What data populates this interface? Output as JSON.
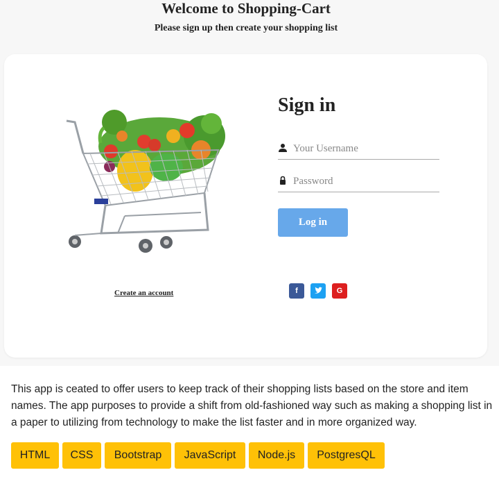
{
  "header": {
    "title": "Welcome to Shopping-Cart",
    "subtitle": "Please sign up then create your shopping list"
  },
  "signin": {
    "title": "Sign in",
    "username_placeholder": "Your Username",
    "password_placeholder": "Password",
    "login_label": "Log in",
    "create_account_label": "Create an account"
  },
  "social": [
    {
      "icon": "facebook-icon",
      "glyph": "f",
      "color": "#3b5998"
    },
    {
      "icon": "twitter-icon",
      "glyph": "t",
      "color": "#1da1f2"
    },
    {
      "icon": "google-icon",
      "glyph": "G",
      "color": "#dd1f1f"
    }
  ],
  "description": "This app is ceated to offer users to keep track of their shopping lists based on the store and item names. The app purposes to provide a shift from old-fashioned way such as making a shopping list in a paper to utilizing from technology to make the list faster and in more organized way.",
  "tech_badges": [
    "HTML",
    "CSS",
    "Bootstrap",
    "JavaScript",
    "Node.js",
    "PostgresQL"
  ],
  "colors": {
    "accent_button": "#67a8ea",
    "badge": "#ffc107"
  }
}
